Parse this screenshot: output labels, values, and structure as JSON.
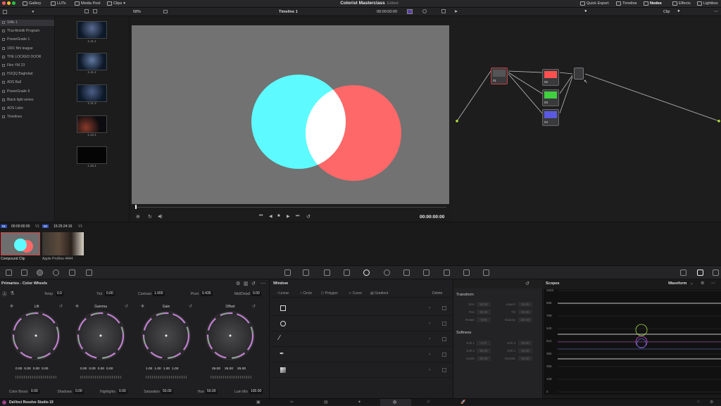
{
  "topbar": {
    "gallery": "Gallery",
    "luts": "LUTs",
    "media_pool": "Media Pool",
    "clips": "Clips",
    "project_title": "Colorist Masterclass",
    "status": "Edited",
    "quick_export": "Quick Export",
    "timeline": "Timeline",
    "nodes": "Nodes",
    "effects": "Effects",
    "lightbox": "Lightbox"
  },
  "viewer_bar": {
    "zoom": "58%",
    "timeline_name": "Timeline 1",
    "mode": "Clip"
  },
  "gallery": {
    "albums": [
      "Stills 1",
      "Thai Airistik Program",
      "PowerGrade 1",
      "1001 film league",
      "THE LOCKED DOOR",
      "Film YM 23",
      "HUQQ Baghdad",
      "ADS Ball",
      "PowerGrade 9",
      "Black light series",
      "ADS Lobn",
      "Timelines"
    ]
  },
  "stills": {
    "labels": [
      "1.11.1",
      "1.11.2",
      "1.11.3",
      "1.12.1",
      "1.15.1"
    ]
  },
  "viewer": {
    "timecode_right": "00:00:00:00"
  },
  "nodes": {
    "labels": [
      "01",
      "02",
      "03",
      "04"
    ]
  },
  "clips": {
    "clip1_num": "01",
    "clip1_tc": "00:00:00:00",
    "clip1_track": "V1",
    "clip2_num": "02",
    "clip2_tc": "15:25:24:16",
    "clip2_track": "V1",
    "clip1_name": "Compound Clip",
    "clip2_name": "Apple ProRes 4444"
  },
  "primaries": {
    "title": "Primaries - Color Wheels",
    "params_top": [
      {
        "label": "Temp",
        "value": "0.0"
      },
      {
        "label": "Tint",
        "value": "0.00"
      },
      {
        "label": "Contrast",
        "value": "1.000"
      },
      {
        "label": "Pivot",
        "value": "0.435"
      },
      {
        "label": "Mid/Detail",
        "value": "0.00"
      }
    ],
    "wheels": [
      {
        "name": "Lift",
        "vals": [
          "0.00",
          "0.00",
          "0.00",
          "0.00"
        ]
      },
      {
        "name": "Gamma",
        "vals": [
          "0.00",
          "0.00",
          "0.00",
          "0.00"
        ]
      },
      {
        "name": "Gain",
        "vals": [
          "1.00",
          "1.00",
          "1.00",
          "1.00"
        ]
      },
      {
        "name": "Offset",
        "vals": [
          "25.00",
          "25.00",
          "25.00"
        ]
      }
    ],
    "params_bottom": [
      {
        "label": "Color Boost",
        "value": "0.00"
      },
      {
        "label": "Shadows",
        "value": "0.00"
      },
      {
        "label": "Highlights",
        "value": "0.00"
      },
      {
        "label": "Saturation",
        "value": "50.00"
      },
      {
        "label": "Hue",
        "value": "50.00"
      },
      {
        "label": "Lum Mix",
        "value": "100.00"
      }
    ]
  },
  "window": {
    "title": "Window",
    "tools": [
      "Linear",
      "Circle",
      "Polygon",
      "Curve",
      "Gradient"
    ],
    "delete": "Delete"
  },
  "transform": {
    "title": "Transform",
    "rows": [
      {
        "l1": "Size",
        "v1": "50.00",
        "l2": "Aspect",
        "v2": "50.00"
      },
      {
        "l1": "Pan",
        "v1": "50.00",
        "l2": "Tilt",
        "v2": "50.00"
      },
      {
        "l1": "Rotate",
        "v1": "0.00",
        "l2": "Opacity",
        "v2": "100.00"
      }
    ],
    "softness_title": "Softness",
    "soft_rows": [
      {
        "l1": "Soft 1",
        "v1": "2.47",
        "l2": "Soft 3",
        "v2": "50.00"
      },
      {
        "l1": "Soft 2",
        "v1": "50.00",
        "l2": "Soft 4",
        "v2": "50.00"
      },
      {
        "l1": "Inside",
        "v1": "50.00",
        "l2": "Outside",
        "v2": "50.00"
      }
    ]
  },
  "scopes": {
    "title": "Scopes",
    "mode": "Waveform",
    "ticks": [
      "1023",
      "896",
      "768",
      "640",
      "512",
      "384",
      "256",
      "128",
      "0"
    ]
  },
  "bottombar": {
    "app_name": "DaVinci Resolve Studio 19"
  }
}
